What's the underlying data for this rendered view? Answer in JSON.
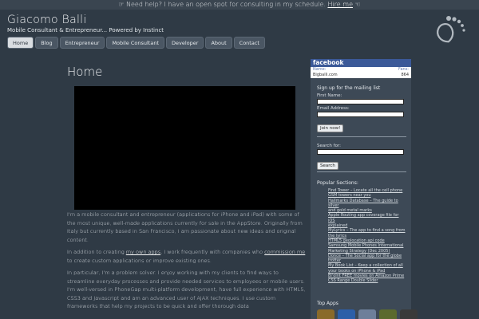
{
  "topbar": {
    "text": "☞ Need help? I have an open spot for consulting in my schedule.",
    "link": "Hire me",
    "suffix": "☜"
  },
  "header": {
    "title": "Giacomo Balli",
    "tagline": "Mobile Consultant & Entrepreneur... Powered by Instinct"
  },
  "nav": [
    {
      "label": "Home"
    },
    {
      "label": "Blog"
    },
    {
      "label": "Entrepreneur"
    },
    {
      "label": "Mobile Consultant"
    },
    {
      "label": "Developer"
    },
    {
      "label": "About"
    },
    {
      "label": "Contact"
    }
  ],
  "main": {
    "heading": "Home",
    "p1": "I'm a mobile consultant and entrepreneur (applications for iPhone and iPad) with some of the most unique, well-made applications currently for sale in the AppStore.  Originally from Italy but currently based in San Francisco, I am passionate about new ideas and original content.",
    "p2_start": "In addition to creating ",
    "p2_link1": "my own apps",
    "p2_mid": ", I work frequently with companies who ",
    "p2_link2": "commission me",
    "p2_end": " to create custom applications or improve existing ones.",
    "p3": "In particular, I'm a problem solver. I enjoy working with my clients to find ways to streamline everyday processes and provide needed services to employees or mobile users. I'm well-versed in PhoneGap multi-platform development, have full experience with HTML5, CSS3 and Javascript and am an advanced user of AJAX techniques.  I use custom frameworks that help my projects to be quick and offer thorough data"
  },
  "sidebar": {
    "facebook": {
      "brand": "facebook",
      "name_label": "Name:",
      "name_value": "Bigballi.com",
      "fans_label": "Fans:",
      "fans_value": "864"
    },
    "mailing": {
      "title": "Sign up for the mailing list",
      "first_name_label": "First Name:",
      "email_label": "Email Address:",
      "button": "Join now!"
    },
    "search": {
      "title": "Search for:",
      "button": "Search"
    },
    "popular": {
      "title": "Popular Sections:",
      "items": [
        "Find Tower – Locate all the cell phone",
        "GSM towers near you",
        "Hallmarks Database – The guide to silver",
        "and gold metal marks",
        "Apple Routing app coverage file for iOS",
        "explained",
        "MyLyrics – The app to find a song from",
        "the lyrics",
        "HTML5 geolocation api code",
        "Samsung Mobile Phones International",
        "Marketing Strategy (Dec 2005)",
        "Donce – The Social app for the globe",
        "trotter",
        "My Book List – Keep a collection of all",
        "your books on iPhone & iPad",
        "Bi'oInt FREE movies on Amazon Prime",
        "CSS Range Double Slider"
      ]
    },
    "top_apps": {
      "title": "Top Apps",
      "icon_colors": [
        "#8a6a2a",
        "#2c5fa8",
        "#6d7f9a",
        "#5b6a2e",
        "#3a3a3a"
      ]
    }
  }
}
